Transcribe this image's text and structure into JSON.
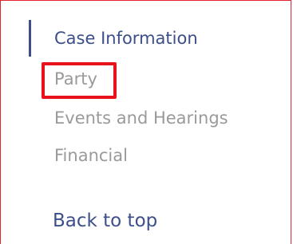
{
  "nav": {
    "items": [
      {
        "label": "Case Information",
        "state": "active"
      },
      {
        "label": "Party",
        "state": "inactive"
      },
      {
        "label": "Events and Hearings",
        "state": "inactive"
      },
      {
        "label": "Financial",
        "state": "inactive"
      }
    ],
    "back_to_top": "Back to top"
  },
  "colors": {
    "active_text": "#3c4f8a",
    "inactive_text": "#9a9a9a",
    "highlight": "#e8121c",
    "border": "#e6232a"
  }
}
